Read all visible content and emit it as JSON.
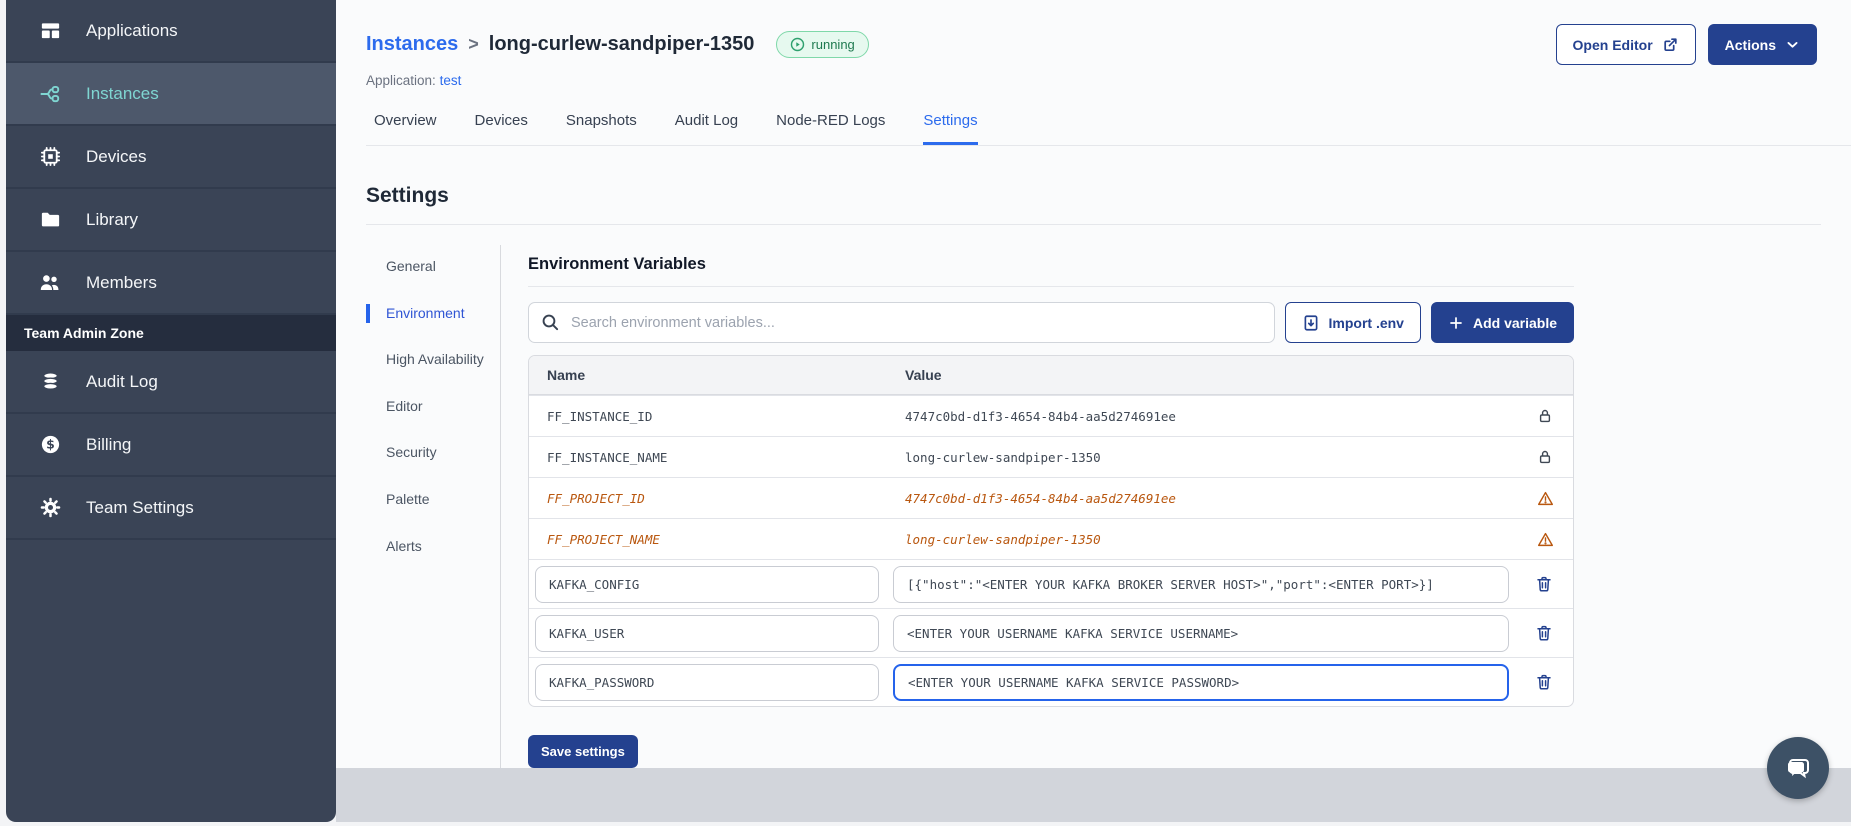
{
  "sidebar": {
    "items": [
      {
        "label": "Applications"
      },
      {
        "label": "Instances"
      },
      {
        "label": "Devices"
      },
      {
        "label": "Library"
      },
      {
        "label": "Members"
      }
    ],
    "section_label": "Team Admin Zone",
    "admin_items": [
      {
        "label": "Audit Log"
      },
      {
        "label": "Billing"
      },
      {
        "label": "Team Settings"
      }
    ]
  },
  "header": {
    "breadcrumb_root": "Instances",
    "breadcrumb_separator": ">",
    "instance_name": "long-curlew-sandpiper-1350",
    "status_badge": "running",
    "application_label": "Application:",
    "application_name": "test",
    "open_editor_label": "Open Editor",
    "actions_label": "Actions"
  },
  "tabs": [
    "Overview",
    "Devices",
    "Snapshots",
    "Audit Log",
    "Node-RED Logs",
    "Settings"
  ],
  "active_tab": "Settings",
  "settings": {
    "title": "Settings",
    "nav": [
      "General",
      "Environment",
      "High Availability",
      "Editor",
      "Security",
      "Palette",
      "Alerts"
    ],
    "active_nav": "Environment"
  },
  "env": {
    "title": "Environment Variables",
    "search_placeholder": "Search environment variables...",
    "import_label": "Import .env",
    "add_label": "Add variable",
    "columns": {
      "name": "Name",
      "value": "Value"
    },
    "rows": [
      {
        "name": "FF_INSTANCE_ID",
        "value": "4747c0bd-d1f3-4654-84b4-aa5d274691ee",
        "state": "locked"
      },
      {
        "name": "FF_INSTANCE_NAME",
        "value": "long-curlew-sandpiper-1350",
        "state": "locked"
      },
      {
        "name": "FF_PROJECT_ID",
        "value": "4747c0bd-d1f3-4654-84b4-aa5d274691ee",
        "state": "deprecated"
      },
      {
        "name": "FF_PROJECT_NAME",
        "value": "long-curlew-sandpiper-1350",
        "state": "deprecated"
      },
      {
        "name": "KAFKA_CONFIG",
        "value": "[{\"host\":\"<ENTER YOUR KAFKA BROKER SERVER HOST>\",\"port\":<ENTER PORT>}]",
        "state": "editable"
      },
      {
        "name": "KAFKA_USER",
        "value": "<ENTER YOUR USERNAME KAFKA SERVICE USERNAME>",
        "state": "editable"
      },
      {
        "name": "KAFKA_PASSWORD",
        "value": "<ENTER YOUR USERNAME KAFKA SERVICE PASSWORD>",
        "state": "editable-focused"
      }
    ],
    "save_label": "Save settings"
  },
  "colors": {
    "sidebar_bg": "#3a4456",
    "sidebar_active_bg": "#4d586b",
    "sidebar_active_text": "#7fd6d2",
    "accent_navy": "#24418f",
    "link_blue": "#2c6bed",
    "nav_active_blue": "#2f55d4",
    "focus_blue": "#2563eb",
    "status_green_text": "#1f7a50",
    "status_green_bg": "#e6f9ef",
    "deprecated_orange": "#b9570f",
    "footer_band": "#d2d5db"
  }
}
